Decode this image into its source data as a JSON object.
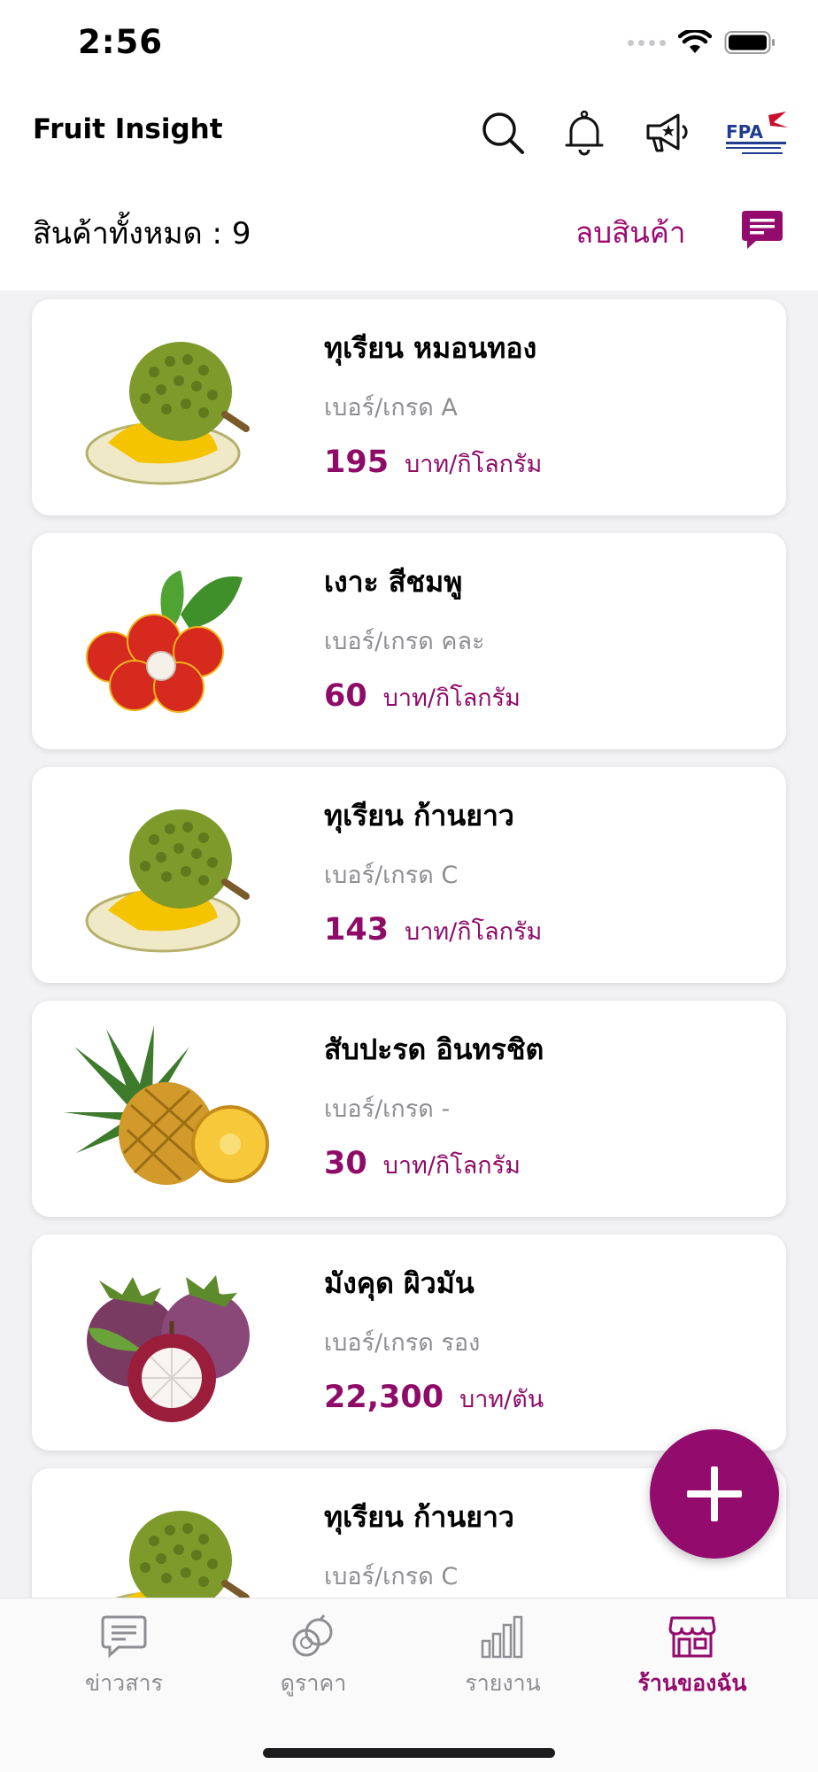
{
  "status_bar": {
    "time": "2:56"
  },
  "header": {
    "title": "Fruit Insight",
    "icons": [
      "search-icon",
      "bell-icon",
      "megaphone-icon"
    ],
    "logo_text": "FPA"
  },
  "summary": {
    "total_label": "สินค้าทั้งหมด : 9",
    "delete_label": "ลบสินค้า"
  },
  "colors": {
    "brand": "#930b6c",
    "price": "#8e0c68",
    "muted": "#8e8e93"
  },
  "products": [
    {
      "name": "ทุเรียน หมอนทอง",
      "grade": "เบอร์/เกรด A",
      "price": "195",
      "unit": "บาท/กิโลกรัม",
      "image": "durian"
    },
    {
      "name": "เงาะ สีชมพู",
      "grade": "เบอร์/เกรด คละ",
      "price": "60",
      "unit": "บาท/กิโลกรัม",
      "image": "rambutan"
    },
    {
      "name": "ทุเรียน ก้านยาว",
      "grade": "เบอร์/เกรด C",
      "price": "143",
      "unit": "บาท/กิโลกรัม",
      "image": "durian"
    },
    {
      "name": "สับปะรด อินทรชิต",
      "grade": "เบอร์/เกรด -",
      "price": "30",
      "unit": "บาท/กิโลกรัม",
      "image": "pineapple"
    },
    {
      "name": "มังคุด ผิวมัน",
      "grade": "เบอร์/เกรด รอง",
      "price": "22,300",
      "unit": "บาท/ตัน",
      "image": "mangosteen"
    },
    {
      "name": "ทุเรียน ก้านยาว",
      "grade": "เบอร์/เกรด C",
      "price": "",
      "unit": "",
      "image": "durian"
    }
  ],
  "tabs": [
    {
      "label": "ข่าวสาร",
      "icon": "news-icon",
      "active": false
    },
    {
      "label": "ดูราคา",
      "icon": "fruit-price-icon",
      "active": false
    },
    {
      "label": "รายงาน",
      "icon": "bar-chart-icon",
      "active": false
    },
    {
      "label": "ร้านของฉัน",
      "icon": "store-icon",
      "active": true
    }
  ]
}
